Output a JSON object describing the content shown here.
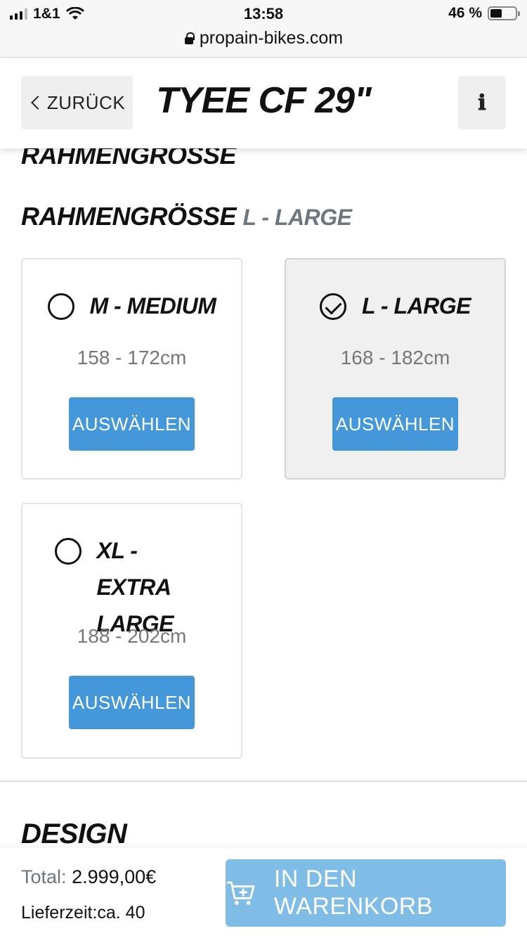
{
  "status_bar": {
    "carrier": "1&1",
    "time": "13:58",
    "battery": "46 %",
    "battery_level": 0.46,
    "url": "propain-bikes.com"
  },
  "header": {
    "back_label": "ZURÜCK",
    "title": "TYEE CF 29\"",
    "info_icon": "info-icon"
  },
  "section_cut_title": "RAHMENGROSSE",
  "frame_size": {
    "heading": "RAHMENGRÖSSE",
    "selected_value": "L - LARGE",
    "options": [
      {
        "label": "M - MEDIUM",
        "range": "158 - 172cm",
        "button": "AUSWÄHLEN",
        "selected": false
      },
      {
        "label": "L - LARGE",
        "range": "168 - 182cm",
        "button": "AUSWÄHLEN",
        "selected": true
      },
      {
        "label": "XL - EXTRA LARGE",
        "range": "188 - 202cm",
        "button": "AUSWÄHLEN",
        "selected": false
      }
    ]
  },
  "design_heading": "DESIGN",
  "footer": {
    "total_label": "Total:",
    "total_value": "2.999,00€",
    "delivery": "Lieferzeit:ca. 40",
    "cart_button": "IN DEN WARENKORB"
  },
  "colors": {
    "accent": "#4498d9",
    "cart_button": "#7fbde6",
    "muted_text": "#6d7780"
  }
}
